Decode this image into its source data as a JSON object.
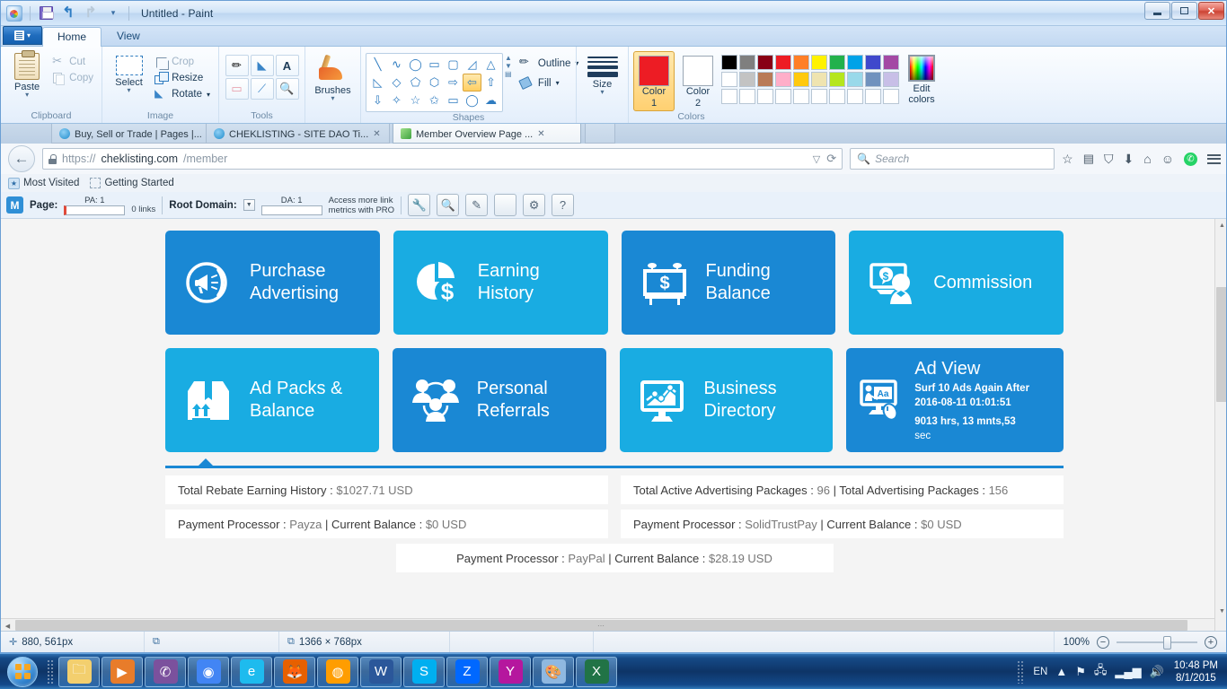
{
  "paint": {
    "window_title": "Untitled - Paint",
    "quick_access": [
      "paint-logo",
      "save-icon",
      "undo-icon",
      "redo-icon",
      "customize-caret"
    ],
    "tabs": [
      {
        "label": "Home",
        "active": true
      },
      {
        "label": "View",
        "active": false
      }
    ],
    "file_tab_label": "",
    "groups": {
      "clipboard": {
        "label": "Clipboard",
        "paste": "Paste",
        "cut": "Cut",
        "copy": "Copy"
      },
      "image": {
        "label": "Image",
        "select": "Select",
        "crop": "Crop",
        "resize": "Resize",
        "rotate": "Rotate"
      },
      "tools": {
        "label": "Tools",
        "items": [
          "pencil-icon",
          "fill-icon",
          "text-icon",
          "eraser-icon",
          "color-picker-icon",
          "magnifier-icon"
        ]
      },
      "brushes": {
        "label": "Brushes"
      },
      "shapes": {
        "label": "Shapes",
        "outline": "Outline",
        "fill": "Fill",
        "selected_shape": "left-arrow-shape"
      },
      "size": {
        "label": "Size"
      },
      "colors": {
        "label": "Colors",
        "color1_label": "Color 1",
        "color2_label": "Color 2",
        "color1_value": "#ED1C24",
        "color2_value": "#FFFFFF",
        "edit_colors": "Edit colors",
        "row1": [
          "#000000",
          "#7f7f7f",
          "#880015",
          "#ed1c24",
          "#ff7f27",
          "#fff200",
          "#22b14c",
          "#00a2e8",
          "#3f48cc",
          "#a349a4"
        ],
        "row2": [
          "#ffffff",
          "#c3c3c3",
          "#b97a57",
          "#ffaec9",
          "#ffc90e",
          "#efe4b0",
          "#b5e61d",
          "#99d9ea",
          "#7092be",
          "#c8bfe7"
        ],
        "row3": [
          "#ffffff",
          "#ffffff",
          "#ffffff",
          "#ffffff",
          "#ffffff",
          "#ffffff",
          "#ffffff",
          "#ffffff",
          "#ffffff",
          "#ffffff"
        ]
      }
    },
    "statusbar": {
      "cursor_position": "880, 561px",
      "selection_size": "",
      "image_size": "1366 × 768px",
      "zoom_level": "100%"
    }
  },
  "browser": {
    "tabs": [
      {
        "label": "Buy, Sell or Trade | Pages |...",
        "active": false
      },
      {
        "label": "CHEKLISTING - SITE DAO Ti...",
        "active": false
      },
      {
        "label": "Member Overview Page  ...",
        "active": true
      }
    ],
    "url_scheme": "https://",
    "url_host": "cheklisting.com",
    "url_path": "/member",
    "search_placeholder": "Search",
    "bookmarks": [
      {
        "label": "Most Visited"
      },
      {
        "label": "Getting Started"
      }
    ],
    "toolbar_icons": [
      "bookmark-star-icon",
      "reading-list-icon",
      "pocket-icon",
      "downloads-icon",
      "home-icon",
      "smiley-icon",
      "whatsapp-icon",
      "hamburger-menu-icon"
    ]
  },
  "mozbar": {
    "page_label": "Page:",
    "pa_label": "PA: 1",
    "links_label": "0 links",
    "root_domain_label": "Root Domain:",
    "da_label": "DA: 1",
    "pro_line1": "Access more link",
    "pro_line2": "metrics with PRO",
    "buttons": [
      "wrench-icon",
      "magnifier-icon",
      "pencil-icon",
      "page-icon",
      "gear-icon",
      "help-icon"
    ]
  },
  "page": {
    "tiles_row1": [
      {
        "title_line1": "Purchase",
        "title_line2": "Advertising",
        "icon": "megaphone-icon",
        "color": "#1a88d4"
      },
      {
        "title_line1": "Earning",
        "title_line2": "History",
        "icon": "pie-chart-dollar-icon",
        "color": "#19ace2"
      },
      {
        "title_line1": "Funding",
        "title_line2": "Balance",
        "icon": "billboard-dollar-icon",
        "color": "#1a88d4"
      },
      {
        "title_line1": "Commission",
        "title_line2": "",
        "icon": "monitor-person-dollar-icon",
        "color": "#19ace2"
      }
    ],
    "tiles_row2": [
      {
        "title_line1": "Ad Packs &",
        "title_line2": "Balance",
        "icon": "package-box-icon",
        "color": "#19ace2"
      },
      {
        "title_line1": "Personal",
        "title_line2": "Referrals",
        "icon": "people-network-icon",
        "color": "#1a88d4"
      },
      {
        "title_line1": "Business",
        "title_line2": "Directory",
        "icon": "monitor-chart-icon",
        "color": "#19ace2"
      }
    ],
    "adview": {
      "color": "#1a88d4",
      "icon": "monitor-presentation-mouse-icon",
      "heading": "Ad View",
      "line1": "Surf 10 Ads Again After",
      "line2": "2016-08-11 01:01:51",
      "line3": "9013 hrs, 13 mnts,53",
      "line4": "sec"
    },
    "stats_left": [
      {
        "label": "Total Rebate Earning History :",
        "value": "$1027.71 USD",
        "highlighted": true
      },
      {
        "label": "Payment Processor :",
        "value": "Payza",
        "label2": "| Current Balance :",
        "value2": "$0 USD"
      }
    ],
    "stats_right": [
      {
        "label": "Total Active Advertising Packages :",
        "value": "96",
        "label2": "| Total Advertising Packages :",
        "value2": "156"
      },
      {
        "label": "Payment Processor :",
        "value": "SolidTrustPay",
        "label2": "| Current Balance :",
        "value2": "$0 USD"
      }
    ],
    "stats_center": {
      "label": "Payment Processor :",
      "value": "PayPal",
      "label2": "| Current Balance :",
      "value2": "$28.19 USD"
    },
    "annotation": {
      "rect_color": "#e81c23",
      "arrow_color": "#e81c23"
    }
  },
  "taskbar": {
    "items": [
      {
        "name": "windows-explorer",
        "color": "#f3cf6e"
      },
      {
        "name": "windows-media-player",
        "color": "#e87c2a"
      },
      {
        "name": "viber",
        "color": "#7b519d"
      },
      {
        "name": "google-chrome",
        "color": "#4285f4"
      },
      {
        "name": "internet-explorer",
        "color": "#1ebbee"
      },
      {
        "name": "mozilla-firefox",
        "color": "#e66000"
      },
      {
        "name": "avg-antivirus",
        "color": "#ff9d00"
      },
      {
        "name": "microsoft-word",
        "color": "#2b579a"
      },
      {
        "name": "skype",
        "color": "#00aff0"
      },
      {
        "name": "zalo",
        "color": "#0068ff"
      },
      {
        "name": "yahoo-messenger",
        "color": "#b5179e"
      },
      {
        "name": "paint",
        "color": "#8fb8e0"
      },
      {
        "name": "microsoft-excel",
        "color": "#217346"
      }
    ],
    "tray": {
      "language": "EN",
      "icons": [
        "show-hidden-icon",
        "action-center-icon",
        "network-icon",
        "signal-icon",
        "volume-icon"
      ],
      "time": "10:48 PM",
      "date": "8/1/2015"
    }
  }
}
